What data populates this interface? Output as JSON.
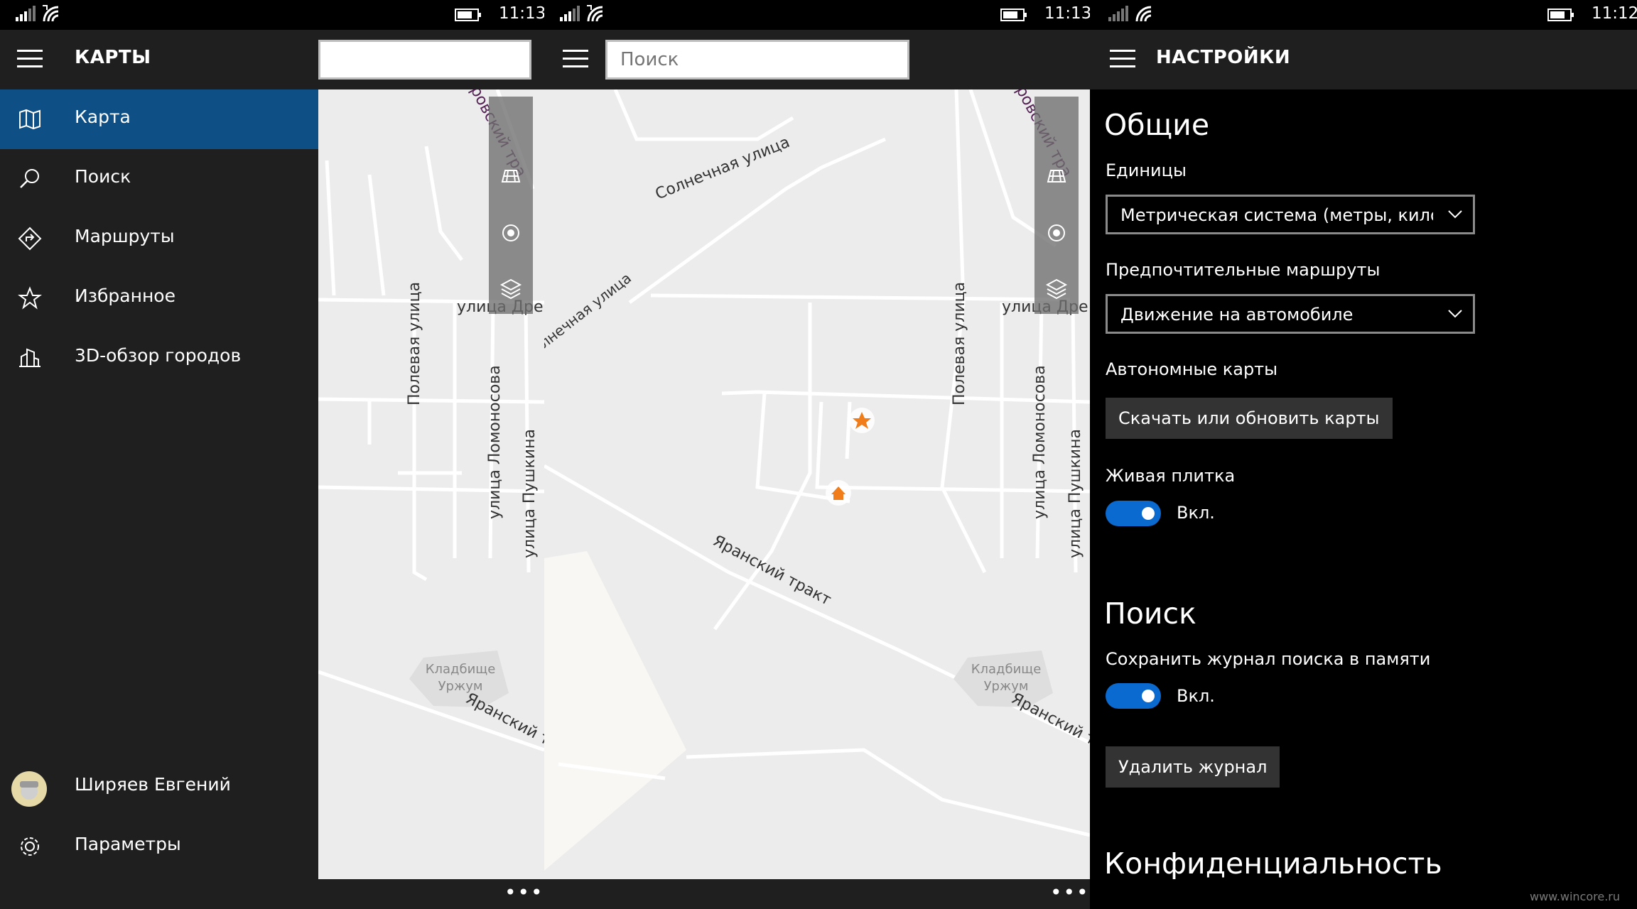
{
  "screens": [
    {
      "time": "11:13"
    },
    {
      "time": "11:13"
    },
    {
      "time": "11:12"
    }
  ],
  "nav": {
    "title": "КАРТЫ",
    "items": [
      {
        "label": "Карта",
        "icon": "map-icon"
      },
      {
        "label": "Поиск",
        "icon": "search-icon"
      },
      {
        "label": "Маршруты",
        "icon": "directions-icon"
      },
      {
        "label": "Избранное",
        "icon": "star-icon"
      },
      {
        "label": "3D-обзор городов",
        "icon": "3d-cities-icon"
      }
    ],
    "user": "Ширяев Евгений",
    "settings_label": "Параметры"
  },
  "map": {
    "search_placeholder": "Поиск",
    "streets": {
      "solnechnaya": "Солнечная  улица",
      "solnechnaya_cut": "лнечная  улица",
      "polevaya": "Полевая  улица",
      "lomonosova": "улица  Ломоносова",
      "pushkina": "улица  Пушкина",
      "dre": "улица  Дре",
      "yaransky": "Яранский  тракт",
      "yaransky_cut": "Яранский  тр",
      "cemetery_1": "Кладбище",
      "cemetery_2": "Уржум",
      "trakt_cut": "ровский  тра"
    },
    "more_glyph": "•••",
    "colors": {
      "background": "#ececec",
      "road": "#ffffff",
      "pin": "#f07d1a"
    }
  },
  "settings": {
    "title": "НАСТРОЙКИ",
    "general_title": "Общие",
    "units_label": "Единицы",
    "units_value": "Метрическая система (метры, килом",
    "routes_label": "Предпочтительные маршруты",
    "routes_value": "Движение на автомобиле",
    "offline_label": "Автономные карты",
    "offline_button": "Скачать или обновить карты",
    "live_tile_label": "Живая плитка",
    "live_tile_state": "Вкл.",
    "search_title": "Поиск",
    "history_label": "Сохранить журнал поиска в памяти",
    "history_state": "Вкл.",
    "delete_history_button": "Удалить журнал",
    "privacy_title": "Конфиденциальность",
    "accent": "#0b6ad0"
  },
  "watermark": "www.wincore.ru"
}
